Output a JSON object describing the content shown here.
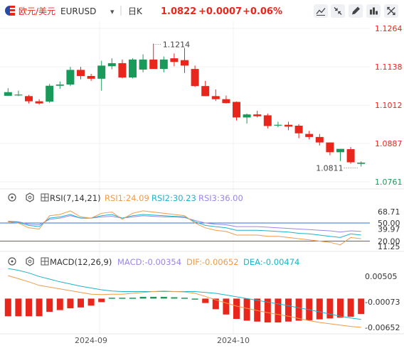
{
  "header": {
    "pair_label": "欧元/美元",
    "symbol": "EURUSD",
    "dropdown_glyph": "▾",
    "period": "日K",
    "price": "1.0822",
    "change": "+0.0007",
    "change_pct": "+0.06%",
    "tool_icons": [
      "line-style-icon",
      "fullscreen-exit-icon",
      "draw-pen-icon",
      "indicator-icon",
      "fullscreen-icon"
    ]
  },
  "colors": {
    "up": "#1a9a5a",
    "down": "#e8261c",
    "blue": "#2a6fdb",
    "rsi1": "#f09b4b",
    "rsi2": "#20b2c8",
    "rsi3": "#9b86e8",
    "macd_label": "#9b86e8",
    "dif": "#f09b4b",
    "dea": "#20b2c8",
    "axis_text": "#e8261c",
    "last_price": "#1a9a5a"
  },
  "rsi_panel": {
    "label": "RSI(7,14,21)",
    "rsi1": "RSI1:24.09",
    "rsi2": "RSI2:30.23",
    "rsi3": "RSI3:36.00",
    "ticks": [
      "68.71",
      "50.00",
      "39.97",
      "20.00",
      "11.25"
    ]
  },
  "macd_panel": {
    "label": "MACD(12,26,9)",
    "macd": "MACD:-0.00354",
    "dif": "DIF:-0.00652",
    "dea": "DEA:-0.00474",
    "ticks": [
      "0.00505",
      "-0.00073",
      "-0.00652"
    ]
  },
  "annotations": {
    "high": "1.1214",
    "low": "1.0811"
  },
  "chart_data": {
    "type": "candlestick",
    "title": "EURUSD",
    "period": "daily",
    "x": [
      "2024-08-28",
      "2024-08-29",
      "2024-08-30",
      "2024-09-02",
      "2024-09-03",
      "2024-09-04",
      "2024-09-05",
      "2024-09-06",
      "2024-09-09",
      "2024-09-10",
      "2024-09-11",
      "2024-09-12",
      "2024-09-13",
      "2024-09-16",
      "2024-09-17",
      "2024-09-18",
      "2024-09-19",
      "2024-09-20",
      "2024-09-23",
      "2024-09-24",
      "2024-09-25",
      "2024-09-26",
      "2024-09-27",
      "2024-09-30",
      "2024-10-01",
      "2024-10-02",
      "2024-10-03",
      "2024-10-04",
      "2024-10-07",
      "2024-10-08",
      "2024-10-09",
      "2024-10-10",
      "2024-10-11",
      "2024-10-14",
      "2024-10-15"
    ],
    "ohlc": [
      [
        1.1043,
        1.1068,
        1.105,
        1.1055
      ],
      [
        1.1046,
        1.106,
        1.1042,
        1.1047
      ],
      [
        1.1042,
        1.1046,
        1.1018,
        1.1025
      ],
      [
        1.1025,
        1.1032,
        1.1014,
        1.1018
      ],
      [
        1.1024,
        1.1082,
        1.102,
        1.1076
      ],
      [
        1.1076,
        1.109,
        1.1066,
        1.108
      ],
      [
        1.108,
        1.1138,
        1.1075,
        1.1128
      ],
      [
        1.1128,
        1.1138,
        1.1097,
        1.1108
      ],
      [
        1.1108,
        1.1115,
        1.1092,
        1.1099
      ],
      [
        1.1099,
        1.1158,
        1.106,
        1.1142
      ],
      [
        1.114,
        1.1166,
        1.113,
        1.115
      ],
      [
        1.115,
        1.1162,
        1.11,
        1.1103
      ],
      [
        1.1103,
        1.1166,
        1.11,
        1.1162
      ],
      [
        1.1129,
        1.1179,
        1.112,
        1.1162
      ],
      [
        1.1162,
        1.1214,
        1.115,
        1.1131
      ],
      [
        1.1131,
        1.1172,
        1.112,
        1.1162
      ],
      [
        1.1166,
        1.1182,
        1.114,
        1.1154
      ],
      [
        1.116,
        1.12,
        1.1118,
        1.1142
      ],
      [
        1.1131,
        1.1142,
        1.1072,
        1.1075
      ],
      [
        1.1075,
        1.1092,
        1.1042,
        1.1042
      ],
      [
        1.1042,
        1.1064,
        1.1026,
        1.1032
      ],
      [
        1.1032,
        1.1044,
        1.1018,
        1.1019
      ],
      [
        1.1023,
        1.1024,
        1.0962,
        1.0972
      ],
      [
        1.0972,
        1.0985,
        1.0952,
        1.0982
      ],
      [
        1.0982,
        1.0994,
        1.0972,
        1.0976
      ],
      [
        1.0979,
        1.0985,
        1.0936,
        1.0944
      ],
      [
        1.0946,
        1.0958,
        1.094,
        1.0948
      ],
      [
        1.0948,
        1.0958,
        1.093,
        1.0942
      ],
      [
        1.0945,
        1.095,
        1.0904,
        1.092
      ],
      [
        1.0918,
        1.0928,
        1.09,
        1.0908
      ],
      [
        1.0908,
        1.0918,
        1.088,
        1.089
      ],
      [
        1.089,
        1.089,
        1.0848,
        1.0858
      ],
      [
        1.0858,
        1.0866,
        1.0829,
        1.0869
      ],
      [
        1.0868,
        1.0875,
        1.082,
        1.0825
      ],
      [
        1.082,
        1.0828,
        1.0811,
        1.0824
      ]
    ],
    "price_axis": [
      "1.1264",
      "1.1138",
      "1.1012",
      "1.0887",
      "1.0761"
    ],
    "last_price": "1.0761",
    "rsi": {
      "rsi1": [
        52,
        50,
        42,
        40,
        62,
        64,
        70,
        60,
        58,
        66,
        68,
        56,
        66,
        70,
        68,
        66,
        64,
        62,
        50,
        42,
        38,
        36,
        30,
        30,
        30,
        28,
        28,
        26,
        24,
        22,
        20,
        18,
        14,
        26,
        24
      ],
      "rsi2": [
        52,
        51,
        46,
        44,
        58,
        60,
        64,
        58,
        58,
        62,
        64,
        58,
        62,
        64,
        63,
        62,
        61,
        60,
        52,
        46,
        44,
        42,
        38,
        38,
        38,
        37,
        36,
        35,
        33,
        32,
        30,
        28,
        26,
        32,
        30
      ],
      "rsi3": [
        53,
        52,
        48,
        47,
        56,
        58,
        62,
        58,
        58,
        60,
        61,
        58,
        60,
        62,
        61,
        60,
        60,
        59,
        54,
        50,
        48,
        47,
        44,
        44,
        44,
        43,
        42,
        41,
        40,
        39,
        38,
        37,
        35,
        37,
        36
      ],
      "levels": [
        50,
        20
      ]
    },
    "macd": {
      "hist": [
        -0.004,
        -0.004,
        -0.004,
        -0.004,
        -0.003,
        -0.0026,
        -0.0022,
        -0.002,
        -0.0016,
        -0.0008,
        0.0002,
        0.0002,
        0.0002,
        0.0004,
        0.0004,
        0.0004,
        0.0003,
        0.0002,
        0.0,
        -0.001,
        -0.0024,
        -0.0036,
        -0.0046,
        -0.005,
        -0.0052,
        -0.0054,
        -0.0054,
        -0.0052,
        -0.005,
        -0.0049,
        -0.0047,
        -0.0045,
        -0.0043,
        -0.0041,
        -0.0035
      ],
      "dif": [
        0.0052,
        0.0045,
        0.0038,
        0.003,
        0.0026,
        0.0022,
        0.0018,
        0.0014,
        0.001,
        0.0009,
        0.001,
        0.001,
        0.0012,
        0.0014,
        0.0016,
        0.0017,
        0.0016,
        0.0015,
        0.0012,
        0.0005,
        -0.0003,
        -0.001,
        -0.0017,
        -0.0022,
        -0.0027,
        -0.0032,
        -0.0036,
        -0.004,
        -0.0045,
        -0.005,
        -0.0054,
        -0.0057,
        -0.006,
        -0.0063,
        -0.0065
      ],
      "dea": [
        0.0068,
        0.0064,
        0.0058,
        0.005,
        0.0044,
        0.0038,
        0.0033,
        0.0028,
        0.0024,
        0.002,
        0.0017,
        0.0016,
        0.0016,
        0.0016,
        0.0016,
        0.0016,
        0.0016,
        0.0016,
        0.0016,
        0.0014,
        0.0012,
        0.0008,
        0.0004,
        0.0,
        -0.0004,
        -0.0008,
        -0.0012,
        -0.0016,
        -0.0021,
        -0.0025,
        -0.003,
        -0.0035,
        -0.004,
        -0.0044,
        -0.0047
      ]
    },
    "x_labels": [
      "2024-09",
      "2024-10"
    ]
  }
}
